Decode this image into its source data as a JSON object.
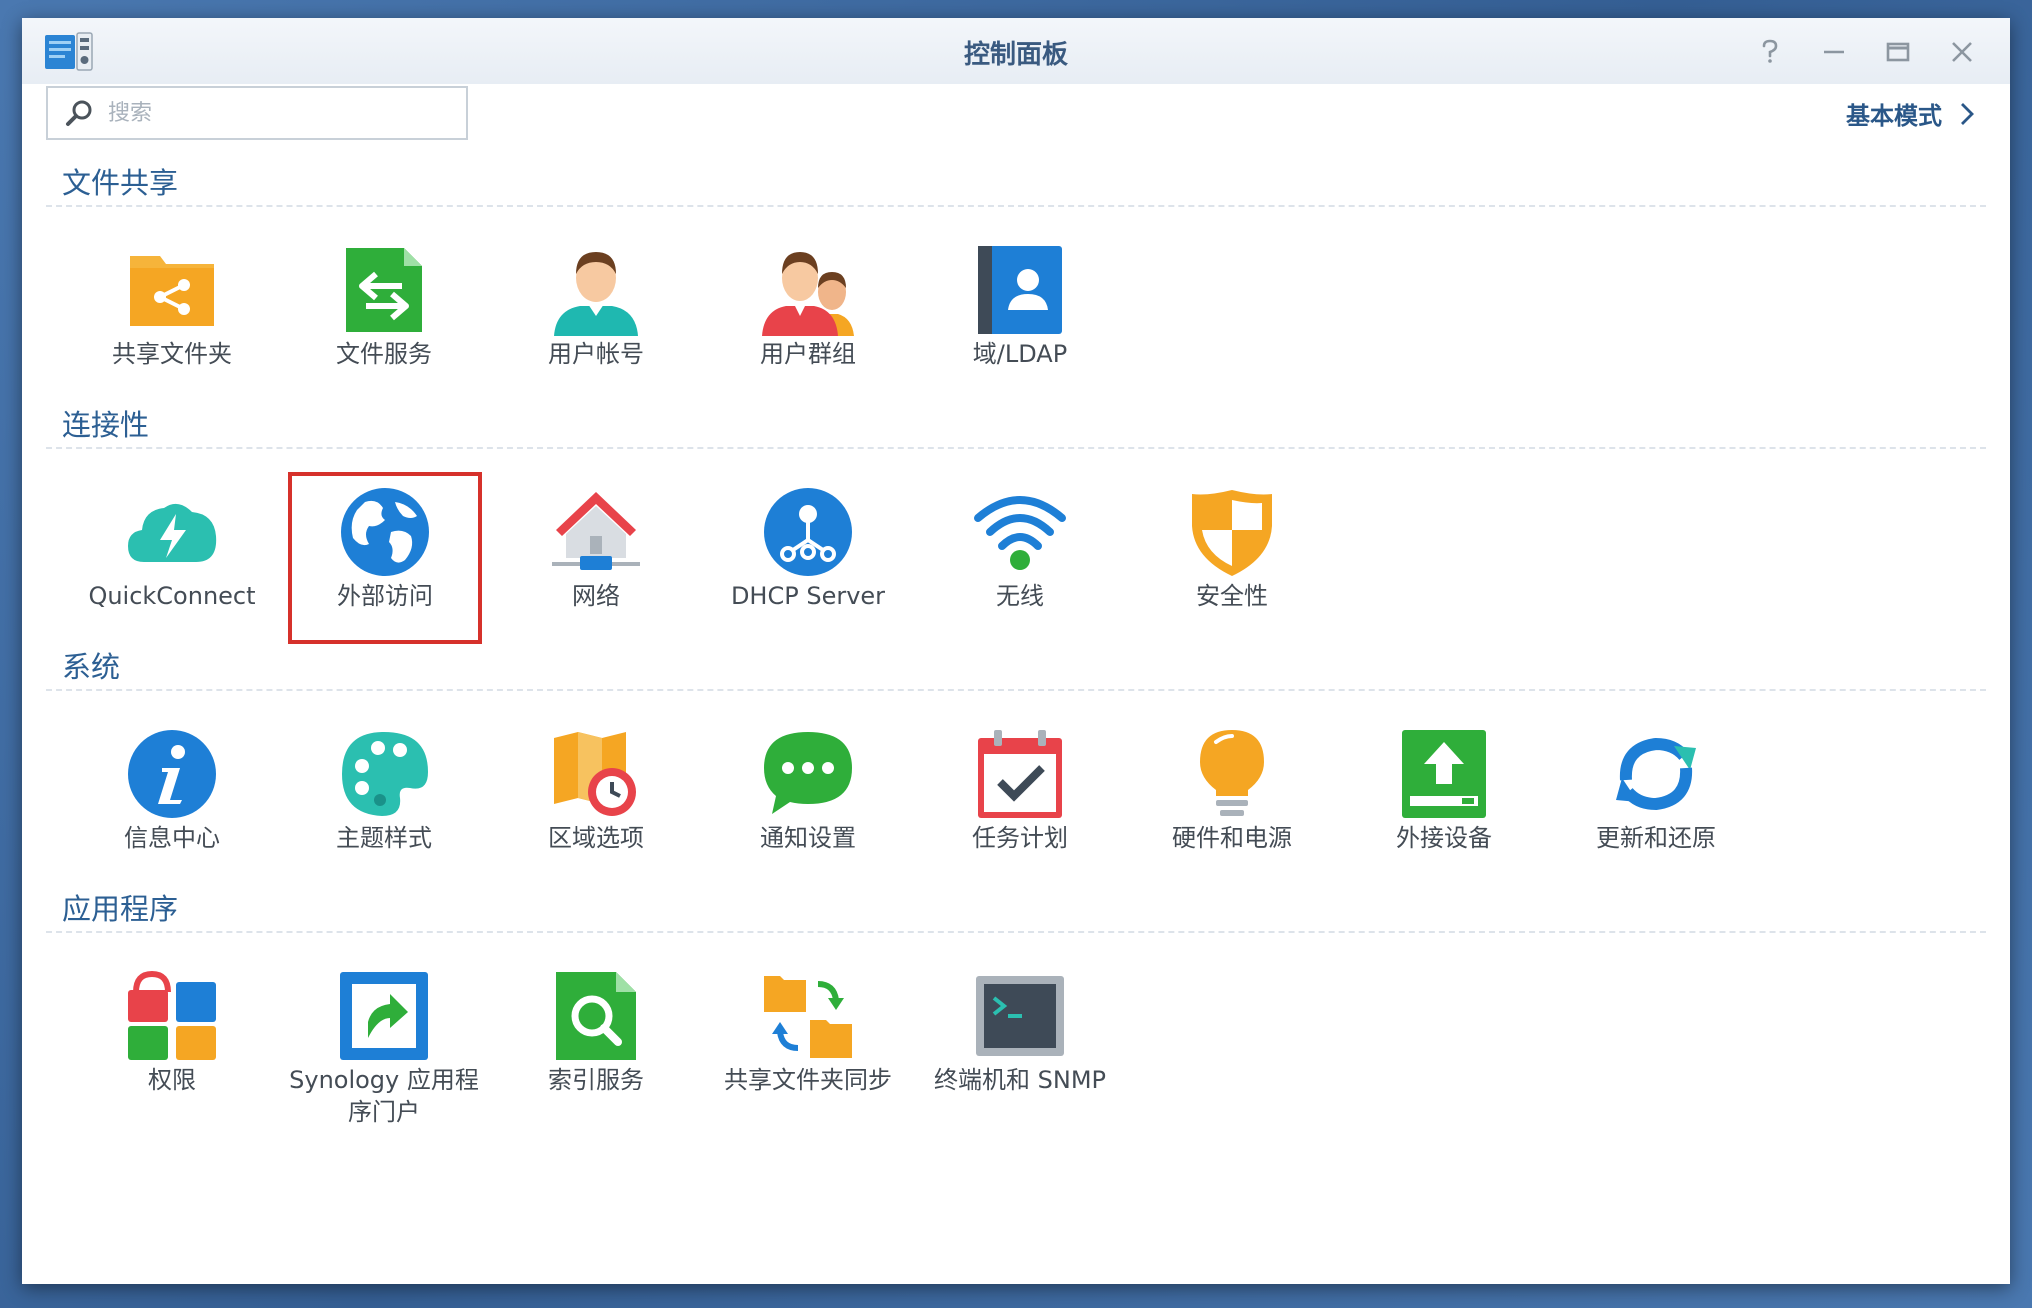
{
  "window": {
    "title": "控制面板"
  },
  "search": {
    "placeholder": "搜索"
  },
  "mode_link": {
    "label": "基本模式"
  },
  "sections": [
    {
      "title": "文件共享",
      "items": [
        {
          "label": "共享文件夹",
          "icon": "shared-folder-icon"
        },
        {
          "label": "文件服务",
          "icon": "file-services-icon"
        },
        {
          "label": "用户帐号",
          "icon": "user-icon"
        },
        {
          "label": "用户群组",
          "icon": "group-icon"
        },
        {
          "label": "域/LDAP",
          "icon": "ldap-icon"
        }
      ]
    },
    {
      "title": "连接性",
      "items": [
        {
          "label": "QuickConnect",
          "icon": "quickconnect-icon"
        },
        {
          "label": "外部访问",
          "icon": "globe-icon",
          "selected": true
        },
        {
          "label": "网络",
          "icon": "network-icon"
        },
        {
          "label": "DHCP Server",
          "icon": "dhcp-icon"
        },
        {
          "label": "无线",
          "icon": "wifi-icon"
        },
        {
          "label": "安全性",
          "icon": "shield-icon"
        }
      ]
    },
    {
      "title": "系统",
      "items": [
        {
          "label": "信息中心",
          "icon": "info-icon"
        },
        {
          "label": "主题样式",
          "icon": "palette-icon"
        },
        {
          "label": "区域选项",
          "icon": "regional-options-icon"
        },
        {
          "label": "通知设置",
          "icon": "notification-icon"
        },
        {
          "label": "任务计划",
          "icon": "task-scheduler-icon"
        },
        {
          "label": "硬件和电源",
          "icon": "lightbulb-icon"
        },
        {
          "label": "外接设备",
          "icon": "external-device-icon"
        },
        {
          "label": "更新和还原",
          "icon": "update-restore-icon"
        }
      ]
    },
    {
      "title": "应用程序",
      "items": [
        {
          "label": "权限",
          "icon": "privileges-icon"
        },
        {
          "label": "Synology 应用程序门户",
          "label_line1": "Synology 应用程",
          "label_line2": "序门户",
          "icon": "app-portal-icon"
        },
        {
          "label": "索引服务",
          "icon": "indexing-service-icon"
        },
        {
          "label": "共享文件夹同步",
          "icon": "folder-sync-icon"
        },
        {
          "label": "终端机和 SNMP",
          "icon": "terminal-icon"
        }
      ]
    }
  ],
  "colors": {
    "accent": "#2c5f93",
    "selection": "#d6312b",
    "blue": "#1e7fd6",
    "orange": "#f5a623",
    "green": "#2fae3a",
    "red": "#e8434a"
  }
}
